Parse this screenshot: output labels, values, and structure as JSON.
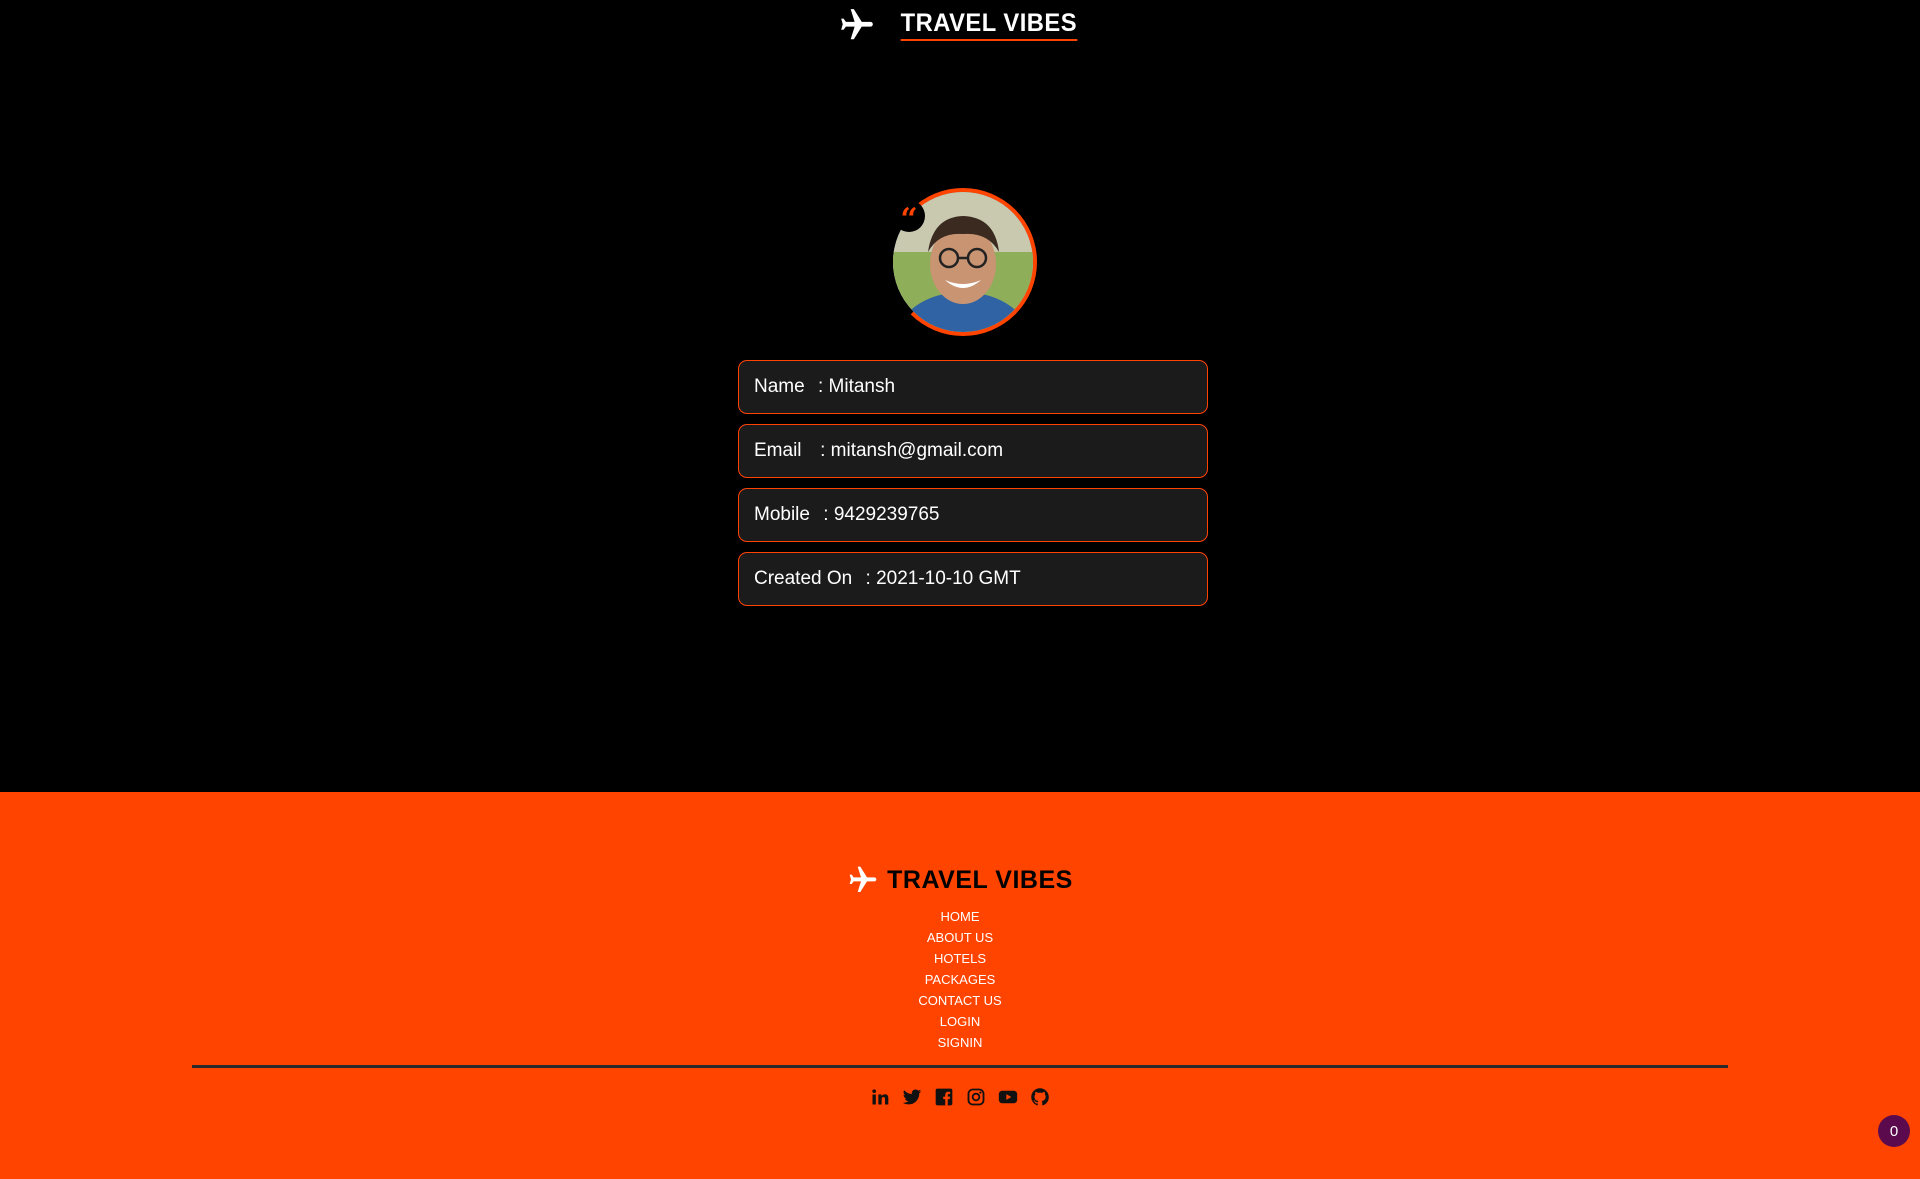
{
  "header": {
    "brand_title": "TRAVEL VIBES"
  },
  "profile": {
    "quote_glyph": "“",
    "fields": [
      {
        "label": "Name ",
        "value": "Mitansh"
      },
      {
        "label": "Email  ",
        "value": "mitansh@gmail.com"
      },
      {
        "label": "Mobile ",
        "value": "9429239765"
      },
      {
        "label": "Created On ",
        "value": "2021-10-10 GMT"
      }
    ]
  },
  "footer": {
    "brand_title": "TRAVEL VIBES",
    "links": [
      "HOME",
      "ABOUT US",
      "HOTELS",
      "PACKAGES",
      "CONTACT US",
      "LOGIN",
      "SIGNIN"
    ],
    "social_icons": [
      "linkedin-icon",
      "twitter-icon",
      "facebook-icon",
      "instagram-icon",
      "youtube-icon",
      "github-icon"
    ]
  },
  "cart_badge": {
    "count": "0"
  },
  "colors": {
    "accent": "#ff4400",
    "background": "#000000",
    "field_bg": "#1b1b1b",
    "badge": "#5b0a4e"
  }
}
